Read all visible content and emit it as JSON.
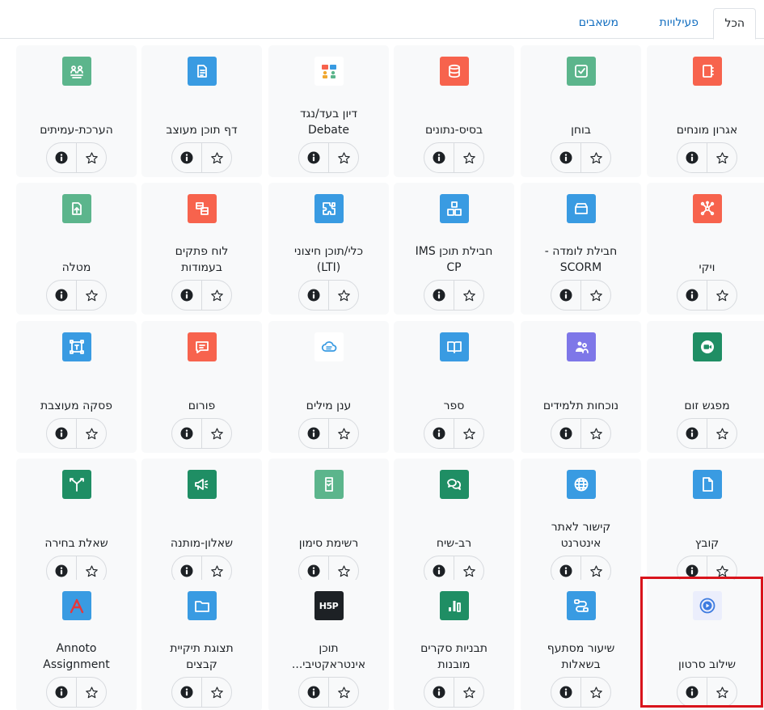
{
  "tabs": [
    {
      "label": "הכל",
      "active": true
    },
    {
      "label": "פעילויות",
      "active": false
    },
    {
      "label": "משאבים",
      "active": false
    }
  ],
  "colors": {
    "communication": "#f7634d",
    "assessment": "#5cb58c",
    "content": "#399be2",
    "collaboration": "#1f8e64",
    "purple": "#7e77e8",
    "dark": "#1d2125",
    "highlight": "#d9141c"
  },
  "modules": [
    {
      "name": "אגרון מונחים",
      "color": "#f7634d",
      "icon": "glossary-icon"
    },
    {
      "name": "בוחן",
      "color": "#5cb58c",
      "icon": "quiz-icon"
    },
    {
      "name": "בסיס-נתונים",
      "color": "#f7634d",
      "icon": "database-icon"
    },
    {
      "name": "דיון בעד/נגד\nDebate",
      "color": "#ffffff",
      "icon": "debate-icon"
    },
    {
      "name": "דף תוכן מעוצב",
      "color": "#399be2",
      "icon": "page-icon"
    },
    {
      "name": "הערכת-עמיתים",
      "color": "#5cb58c",
      "icon": "workshop-icon"
    },
    {
      "name": "ויקי",
      "color": "#f7634d",
      "icon": "wiki-icon"
    },
    {
      "name": "חבילת לומדה -\nSCORM",
      "color": "#399be2",
      "icon": "scorm-icon"
    },
    {
      "name": "חבילת תוכן IMS\nCP",
      "color": "#399be2",
      "icon": "imscp-icon"
    },
    {
      "name": "כלי/תוכן חיצוני\n(LTI)",
      "color": "#399be2",
      "icon": "lti-icon"
    },
    {
      "name": "לוח פתקים\nבעמודות",
      "color": "#f7634d",
      "icon": "board-icon"
    },
    {
      "name": "מטלה",
      "color": "#5cb58c",
      "icon": "assignment-icon"
    },
    {
      "name": "מפגש זום",
      "color": "#1f8e64",
      "icon": "zoom-icon"
    },
    {
      "name": "נוכחות תלמידים",
      "color": "#7e77e8",
      "icon": "attendance-icon"
    },
    {
      "name": "ספר",
      "color": "#399be2",
      "icon": "book-icon"
    },
    {
      "name": "ענן מילים",
      "color": "#ffffff",
      "icon": "wordcloud-icon"
    },
    {
      "name": "פורום",
      "color": "#f7634d",
      "icon": "forum-icon"
    },
    {
      "name": "פסקה מעוצבת",
      "color": "#399be2",
      "icon": "label-icon"
    },
    {
      "name": "קובץ",
      "color": "#399be2",
      "icon": "file-icon"
    },
    {
      "name": "קישור לאתר\nאינטרנט",
      "color": "#399be2",
      "icon": "url-icon"
    },
    {
      "name": "רב-שיח",
      "color": "#1f8e64",
      "icon": "chat-icon"
    },
    {
      "name": "רשימת סימון",
      "color": "#5cb58c",
      "icon": "checklist-icon"
    },
    {
      "name": "שאלון-מותנה",
      "color": "#1f8e64",
      "icon": "questionnaire-icon"
    },
    {
      "name": "שאלת בחירה",
      "color": "#1f8e64",
      "icon": "choice-icon"
    },
    {
      "name": "שילוב סרטון",
      "color": "#ffffff",
      "icon": "video-icon"
    },
    {
      "name": "שיעור מסתעף\nבשאלות",
      "color": "#399be2",
      "icon": "lesson-icon"
    },
    {
      "name": "תבניות סקרים\nמובנות",
      "color": "#1f8e64",
      "icon": "survey-icon"
    },
    {
      "name": "תוכן\nאינטראקטיבי...",
      "color": "#1d2125",
      "icon": "h5p-icon",
      "logo_text": "H5P"
    },
    {
      "name": "תצוגת תיקיית\nקבצים",
      "color": "#399be2",
      "icon": "folder-icon"
    },
    {
      "name": "Annoto\nAssignment",
      "color": "#399be2",
      "icon": "annoto-icon"
    }
  ]
}
